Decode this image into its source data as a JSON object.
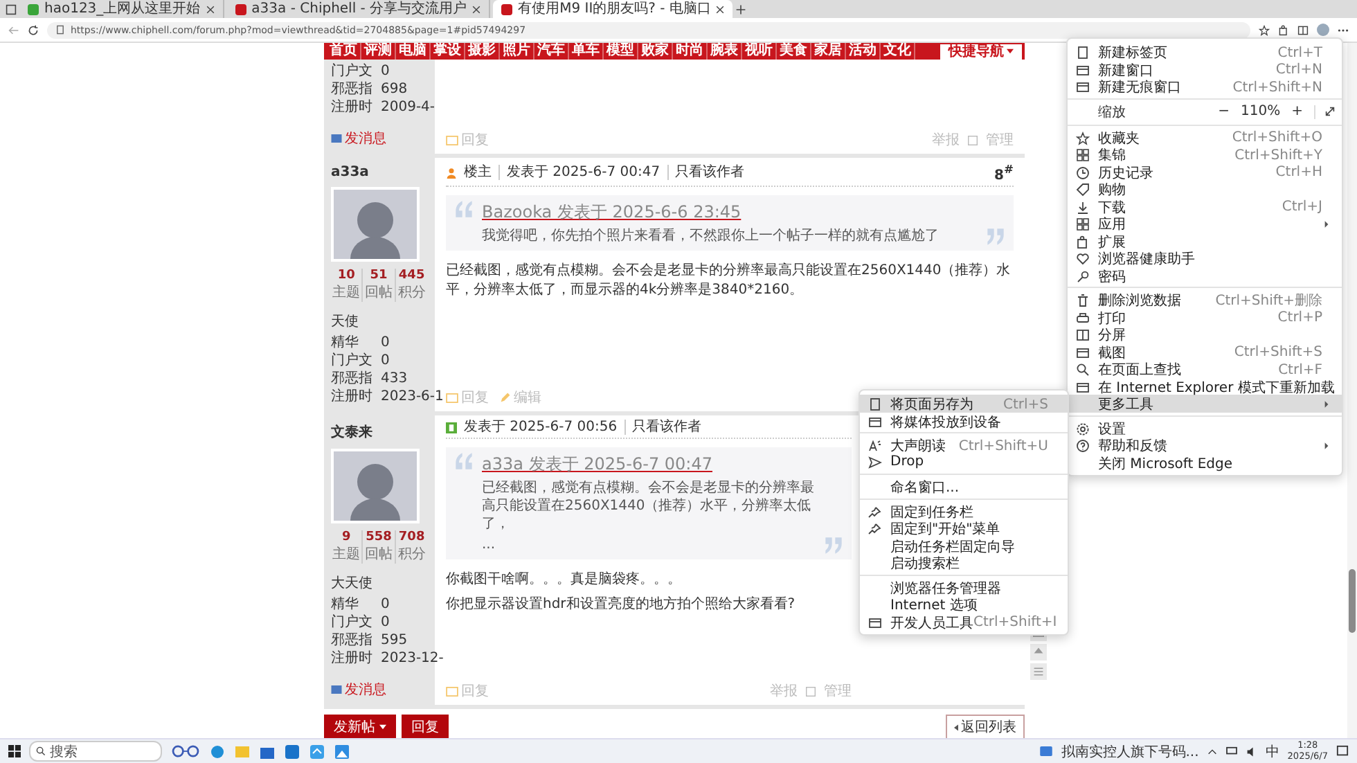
{
  "browser": {
    "tabs": [
      {
        "title": "hao123_上网从这里开始",
        "selected": false
      },
      {
        "title": "a33a - Chiphell - 分享与交流用户",
        "selected": false
      },
      {
        "title": "有使用M9 II的朋友吗? - 电脑口",
        "selected": true
      }
    ],
    "url": "https://www.chiphell.com/forum.php?mod=viewthread&tid=2704885&page=1#pid57494297"
  },
  "nav": {
    "items": [
      "首页",
      "评测",
      "电脑",
      "掌设",
      "摄影",
      "照片",
      "汽车",
      "单车",
      "模型",
      "败家",
      "时尚",
      "腕表",
      "视听",
      "美食",
      "家居",
      "活动",
      "文化"
    ],
    "quick_nav": "快捷导航"
  },
  "posts": [
    {
      "fields": [
        {
          "label": "门户文",
          "value": "0"
        },
        {
          "label": "邪恶指",
          "value": "698"
        },
        {
          "label": "注册时",
          "value": "2009-4-"
        }
      ],
      "send_message": "发消息",
      "actions": [
        "回复"
      ],
      "tools": [
        "举报",
        "管理"
      ]
    },
    {
      "author": "a33a",
      "stats": [
        {
          "value": "10",
          "label": "主题"
        },
        {
          "value": "51",
          "label": "回帖"
        },
        {
          "value": "445",
          "label": "积分"
        }
      ],
      "rank": "天使",
      "fields": [
        {
          "label": "精华",
          "value": "0"
        },
        {
          "label": "门户文",
          "value": "0"
        },
        {
          "label": "邪恶指",
          "value": "433"
        },
        {
          "label": "注册时",
          "value": "2023-6-1"
        }
      ],
      "owner": "楼主",
      "posted": "发表于 2025-6-7 00:47",
      "only_author": "只看该作者",
      "floor": "8$^{#}$",
      "quote": {
        "author_line": "Bazooka 发表于 2025-6-6 23:45",
        "text": "我觉得吧，你先拍个照片来看看，不然跟你上一个帖子一样的就有点尴尬了"
      },
      "body": [
        "已经截图，感觉有点模糊。会不会是老显卡的分辨率最高只能设置在2560X1440（推荐）水平，分辨率太低了，而显示器的4k分辨率是3840*2160。"
      ],
      "actions": [
        "回复",
        "编辑"
      ]
    },
    {
      "author": "文泰来",
      "stats": [
        {
          "value": "9",
          "label": "主题"
        },
        {
          "value": "558",
          "label": "回帖"
        },
        {
          "value": "708",
          "label": "积分"
        }
      ],
      "rank": "大天使",
      "fields": [
        {
          "label": "精华",
          "value": "0"
        },
        {
          "label": "门户文",
          "value": "0"
        },
        {
          "label": "邪恶指",
          "value": "595"
        },
        {
          "label": "注册时",
          "value": "2023-12-"
        }
      ],
      "send_message": "发消息",
      "posted": "发表于 2025-6-7 00:56",
      "only_author": "只看该作者",
      "quote": {
        "author_line": "a33a 发表于 2025-6-7 00:47",
        "text": "已经截图，感觉有点模糊。会不会是老显卡的分辨率最高只能设置在2560X1440（推荐）水平，分辨率太低了，",
        "more": "..."
      },
      "body": [
        "你截图干啥啊。。。真是脑袋疼。。。",
        "你把显示器设置hdr和设置亮度的地方拍个照给大家看看?"
      ],
      "actions": [
        "回复"
      ],
      "tools": [
        "举报",
        "管理"
      ]
    }
  ],
  "bottom": {
    "new_post": "发新帖",
    "reply": "回复",
    "back": "返回列表"
  },
  "menu": {
    "groups": [
      [
        {
          "kind": "item",
          "label": "新建标签页",
          "shortcut": "Ctrl+T",
          "submenu": false,
          "selected": false
        },
        {
          "kind": "item",
          "label": "新建窗口",
          "shortcut": "Ctrl+N",
          "submenu": false,
          "selected": false
        },
        {
          "kind": "item",
          "label": "新建无痕窗口",
          "shortcut": "Ctrl+Shift+N",
          "submenu": false,
          "selected": false
        }
      ],
      [
        {
          "kind": "zoom",
          "label": "缩放",
          "zoom_out": "−",
          "value": "110%",
          "zoom_in": "+"
        }
      ],
      [
        {
          "kind": "item",
          "label": "收藏夹",
          "shortcut": "Ctrl+Shift+O",
          "submenu": false,
          "selected": false
        },
        {
          "kind": "item",
          "label": "集锦",
          "shortcut": "Ctrl+Shift+Y",
          "submenu": false,
          "selected": false
        },
        {
          "kind": "item",
          "label": "历史记录",
          "shortcut": "Ctrl+H",
          "submenu": false,
          "selected": false
        },
        {
          "kind": "item",
          "label": "购物",
          "submenu": false,
          "selected": false
        },
        {
          "kind": "item",
          "label": "下载",
          "shortcut": "Ctrl+J",
          "submenu": false,
          "selected": false
        },
        {
          "kind": "item",
          "label": "应用",
          "submenu": true,
          "selected": false
        },
        {
          "kind": "item",
          "label": "扩展",
          "submenu": false,
          "selected": false
        },
        {
          "kind": "item",
          "label": "浏览器健康助手",
          "submenu": false,
          "selected": false
        },
        {
          "kind": "item",
          "label": "密码",
          "submenu": false,
          "selected": false
        }
      ],
      [
        {
          "kind": "item",
          "label": "删除浏览数据",
          "shortcut": "Ctrl+Shift+删除",
          "submenu": false,
          "selected": false
        },
        {
          "kind": "item",
          "label": "打印",
          "shortcut": "Ctrl+P",
          "submenu": false,
          "selected": false
        },
        {
          "kind": "item",
          "label": "分屏",
          "submenu": false,
          "selected": false
        },
        {
          "kind": "item",
          "label": "截图",
          "shortcut": "Ctrl+Shift+S",
          "submenu": false,
          "selected": false
        },
        {
          "kind": "item",
          "label": "在页面上查找",
          "shortcut": "Ctrl+F",
          "submenu": false,
          "selected": false
        },
        {
          "kind": "item",
          "label": "在 Internet Explorer 模式下重新加载",
          "submenu": false,
          "selected": false
        },
        {
          "kind": "item",
          "label": "更多工具",
          "submenu": true,
          "selected": true
        }
      ],
      [
        {
          "kind": "item",
          "label": "设置",
          "submenu": false,
          "selected": false
        },
        {
          "kind": "item",
          "label": "帮助和反馈",
          "submenu": true,
          "selected": false
        },
        {
          "kind": "item",
          "label": "关闭 Microsoft Edge",
          "submenu": false,
          "selected": false
        }
      ]
    ]
  },
  "submenu": {
    "groups": [
      [
        {
          "kind": "item",
          "label": "将页面另存为",
          "shortcut": "Ctrl+S",
          "submenu": false,
          "selected": true
        },
        {
          "kind": "item",
          "label": "将媒体投放到设备",
          "submenu": false,
          "selected": false
        }
      ],
      [
        {
          "kind": "item",
          "label": "大声朗读",
          "shortcut": "Ctrl+Shift+U",
          "submenu": false,
          "selected": false
        },
        {
          "kind": "item",
          "label": "Drop",
          "submenu": false,
          "selected": false
        }
      ],
      [
        {
          "kind": "item",
          "label": "命名窗口...",
          "submenu": false,
          "selected": false
        }
      ],
      [
        {
          "kind": "item",
          "label": "固定到任务栏",
          "submenu": false,
          "selected": false
        },
        {
          "kind": "item",
          "label": "固定到\"开始\"菜单",
          "submenu": false,
          "selected": false
        },
        {
          "kind": "item",
          "label": "启动任务栏固定向导",
          "submenu": false,
          "selected": false
        },
        {
          "kind": "item",
          "label": "启动搜索栏",
          "submenu": false,
          "selected": false
        }
      ],
      [
        {
          "kind": "item",
          "label": "浏览器任务管理器",
          "submenu": false,
          "selected": false
        },
        {
          "kind": "item",
          "label": "Internet 选项",
          "submenu": false,
          "selected": false
        },
        {
          "kind": "item",
          "label": "开发人员工具",
          "shortcut": "Ctrl+Shift+I",
          "submenu": false,
          "selected": false
        }
      ]
    ]
  },
  "taskbar": {
    "search_placeholder": "搜索",
    "notification": "拟南实控人旗下号码...",
    "ime": "中",
    "time": "1:28",
    "date": "2025/6/7"
  }
}
